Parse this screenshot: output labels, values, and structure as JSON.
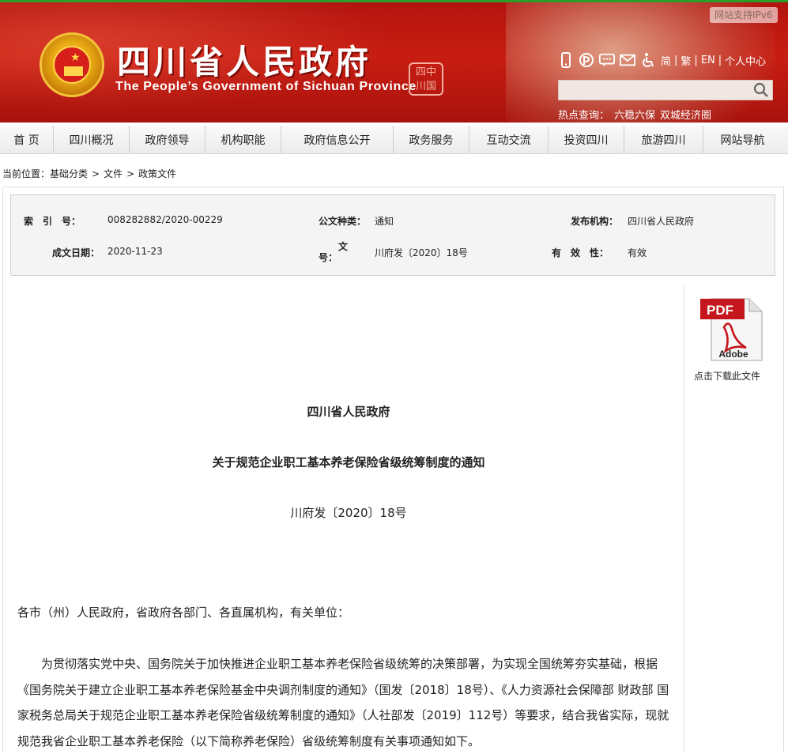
{
  "header": {
    "title": "四川省人民政府",
    "subtitle": "The People’s Government of Sichuan Province",
    "seal_text": "四中\n川国",
    "ipv6_badge": "网站支持IPv6",
    "tools": {
      "simplified": "简",
      "traditional": "繁",
      "english": "EN",
      "personal_center": "个人中心"
    },
    "search": {
      "placeholder": "",
      "value": ""
    },
    "hot": {
      "label": "热点查询：",
      "items": [
        "六稳六保",
        "双城经济圈"
      ]
    },
    "colors": {
      "banner": "#c81d12",
      "ipv6_top_border": "#2a9d2a"
    }
  },
  "nav": {
    "items": [
      "首 页",
      "四川概况",
      "政府领导",
      "机构职能",
      "政府信息公开",
      "政务服务",
      "互动交流",
      "投资四川",
      "旅游四川",
      "网站导航"
    ]
  },
  "breadcrumb": {
    "label": "当前位置：",
    "items": [
      "基础分类",
      "文件",
      "政策文件"
    ],
    "sep": ">"
  },
  "meta": {
    "index_key": "索　引　号：",
    "index_val": "008282882/2020-00229",
    "type_key": "公文种类：",
    "type_val": "通知",
    "issuer_key": "发布机构：",
    "issuer_val": "四川省人民政府",
    "date_key": "成文日期：",
    "date_val": "2020-11-23",
    "docno_key_a": "文",
    "docno_key_b": "号：",
    "docno_val": "川府发〔2020〕18号",
    "valid_key": "有　效　性：",
    "valid_val": "有效"
  },
  "download": {
    "label": "点击下载此文件",
    "icon": "pdf-icon",
    "pdf_text": "PDF",
    "adobe_text": "Adobe"
  },
  "document": {
    "org": "四川省人民政府",
    "title": "关于规范企业职工基本养老保险省级统筹制度的通知",
    "number": "川府发〔2020〕18号",
    "salutation": "各市（州）人民政府，省政府各部门、各直属机构，有关单位：",
    "paragraph": "为贯彻落实党中央、国务院关于加快推进企业职工基本养老保险省级统筹的决策部署，为实现全国统筹夯实基础，根据《国务院关于建立企业职工基本养老保险基金中央调剂制度的通知》（国发〔2018〕18号）、《人力资源社会保障部 财政部 国家税务总局关于规范企业职工基本养老保险省级统筹制度的通知》（人社部发〔2019〕112号）等要求，结合我省实际，现就规范我省企业职工基本养老保险（以下简称养老保险）省级统筹制度有关事项通知如下。"
  }
}
